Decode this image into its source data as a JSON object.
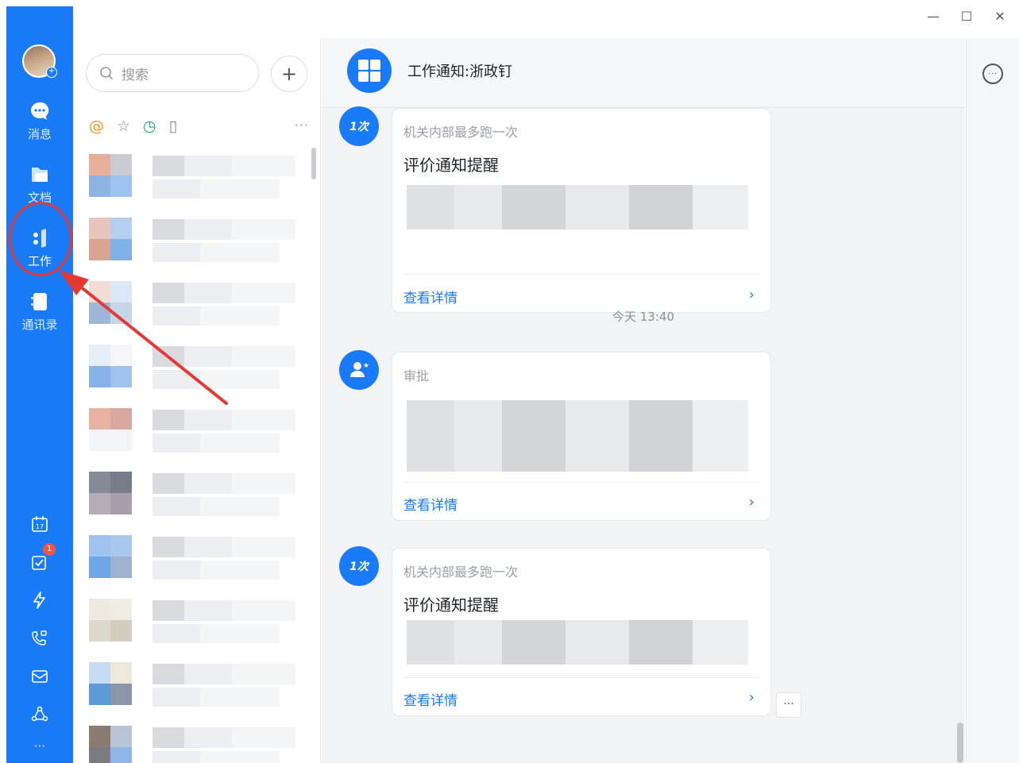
{
  "window": {
    "minimize": "—",
    "maximize": "☐",
    "close": "✕"
  },
  "rail": {
    "items": [
      {
        "label": "消息",
        "icon": "message-bubble-icon"
      },
      {
        "label": "文档",
        "icon": "document-icon"
      },
      {
        "label": "工作",
        "icon": "work-icon"
      },
      {
        "label": "通讯录",
        "icon": "contacts-icon"
      }
    ],
    "todo_badge": "1",
    "more": "···"
  },
  "search": {
    "placeholder": "搜索"
  },
  "list": {
    "more": "···"
  },
  "chat": {
    "title": "工作通知:浙政钉",
    "time_separator": "今天 13:40",
    "messages": [
      {
        "source": "机关内部最多跑一次",
        "title": "评价通知提醒",
        "detail": "查看详情"
      },
      {
        "source": "审批",
        "title": "",
        "detail": "查看详情"
      },
      {
        "source": "机关内部最多跑一次",
        "title": "评价通知提醒",
        "detail": "查看详情"
      }
    ],
    "more_btn": "···"
  },
  "colors": {
    "accent": "#1a7bf8",
    "annotation": "#e53935"
  }
}
